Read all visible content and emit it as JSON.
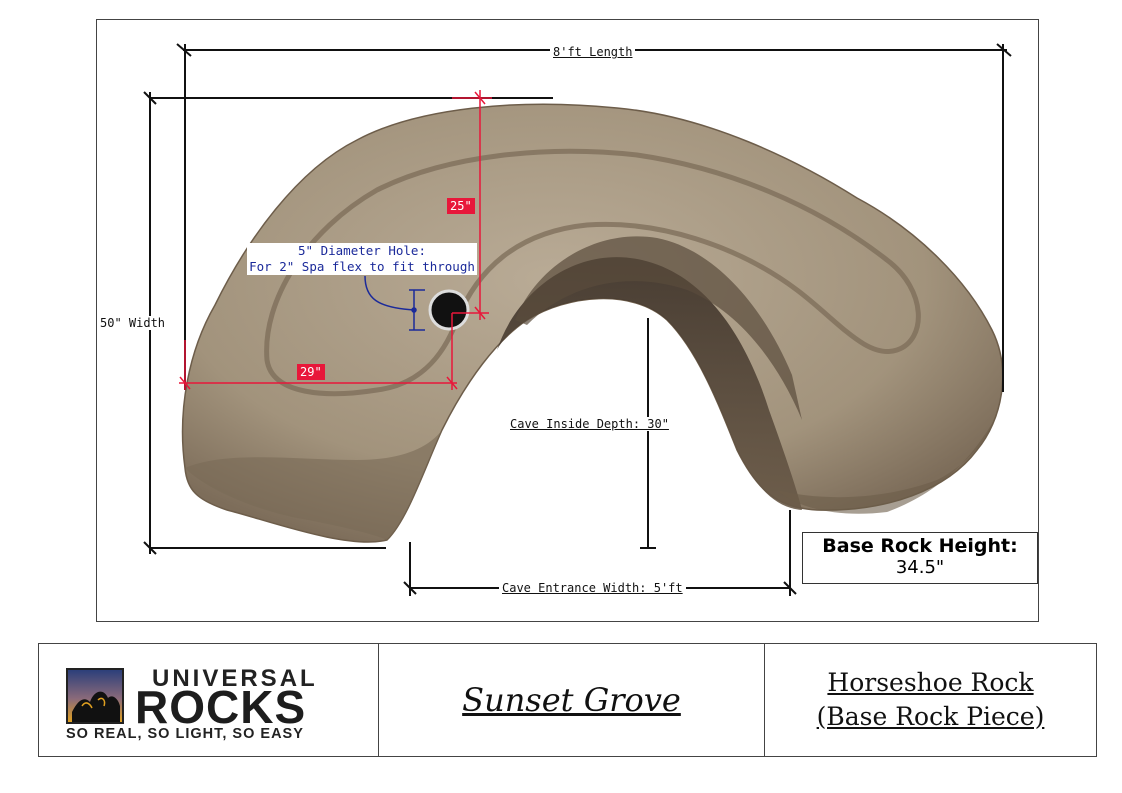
{
  "dimensions": {
    "length": "8'ft Length",
    "width": "50\" Width",
    "hole_to_front": "25\"",
    "hole_to_side": "29\"",
    "cave_depth": "Cave Inside Depth: 30\"",
    "cave_entrance_width": "Cave Entrance Width: 5'ft"
  },
  "hole_note": {
    "line1": "5\" Diameter Hole:",
    "line2": "For 2\" Spa flex to fit through"
  },
  "base_height": {
    "label": "Base Rock Height:",
    "value": "34.5\""
  },
  "title_block": {
    "brand_top": "UNIVERSAL",
    "brand_main": "ROCKS",
    "tagline": "SO REAL, SO LIGHT, SO EASY",
    "project": "Sunset Grove",
    "piece_line1": "Horseshoe Rock",
    "piece_line2": "(Base Rock Piece)"
  },
  "colors": {
    "dimension_red": "#e8173a",
    "note_blue": "#1b2a9a",
    "rock_tan": "#a89a84",
    "cave_dark": "#4b3f33"
  },
  "icons": [
    "horseshoe-rock-photo",
    "universal-rocks-logo-mark"
  ]
}
